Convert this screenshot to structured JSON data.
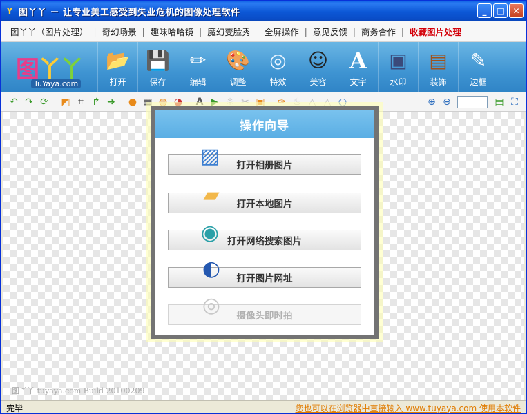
{
  "window": {
    "title": "图丫丫 － 让专业美工感受到失业危机的图像处理软件",
    "controls": {
      "minimize": "_",
      "maximize": "□",
      "close": "✕"
    }
  },
  "menu": {
    "items": [
      "图丫丫（图片处理）",
      "奇幻场景",
      "趣味哈哈镜",
      "魔幻变脸秀",
      "全屏操作",
      "意见反馈",
      "商务合作"
    ],
    "favorite": "收藏图片处理",
    "separator": "|"
  },
  "logo": {
    "text": "TuYaya.com",
    "glyph1": "图",
    "glyph2": "丫",
    "glyph3": "丫"
  },
  "toolbar": {
    "items": [
      {
        "label": "打开",
        "icon": "folder-icon",
        "glyph": "📂"
      },
      {
        "label": "保存",
        "icon": "floppy-disk-icon",
        "glyph": "💾"
      },
      {
        "label": "编辑",
        "icon": "edit-pencil-icon",
        "glyph": "✏"
      },
      {
        "label": "调整",
        "icon": "palette-icon",
        "glyph": "🎨"
      },
      {
        "label": "特效",
        "icon": "sparkle-orb-icon",
        "glyph": "◎"
      },
      {
        "label": "美容",
        "icon": "face-icon",
        "glyph": "☺"
      },
      {
        "label": "文字",
        "icon": "letter-a-icon",
        "glyph": "A"
      },
      {
        "label": "水印",
        "icon": "watermark-icon",
        "glyph": "▣"
      },
      {
        "label": "装饰",
        "icon": "frame-decoration-icon",
        "glyph": "▤"
      },
      {
        "label": "边框",
        "icon": "border-icon",
        "glyph": "✎"
      }
    ]
  },
  "wizard": {
    "title": "操作向导",
    "buttons": [
      {
        "label": "打开相册图片",
        "enabled": true
      },
      {
        "label": "打开本地图片",
        "enabled": true
      },
      {
        "label": "打开网络搜索图片",
        "enabled": true
      },
      {
        "label": "打开图片网址",
        "enabled": true
      },
      {
        "label": "摄像头即时拍",
        "enabled": false
      }
    ]
  },
  "canvas": {
    "build_text": "图丫丫 tuyaya.com Build 20100209"
  },
  "status": {
    "left": "完毕",
    "right": "您也可以在浏览器中直接输入 www.tuyaya.com 使用本软件"
  },
  "colors": {
    "accent": "#3f94d2",
    "hot_menu": "#d4000a",
    "status_link": "#e07b00"
  }
}
